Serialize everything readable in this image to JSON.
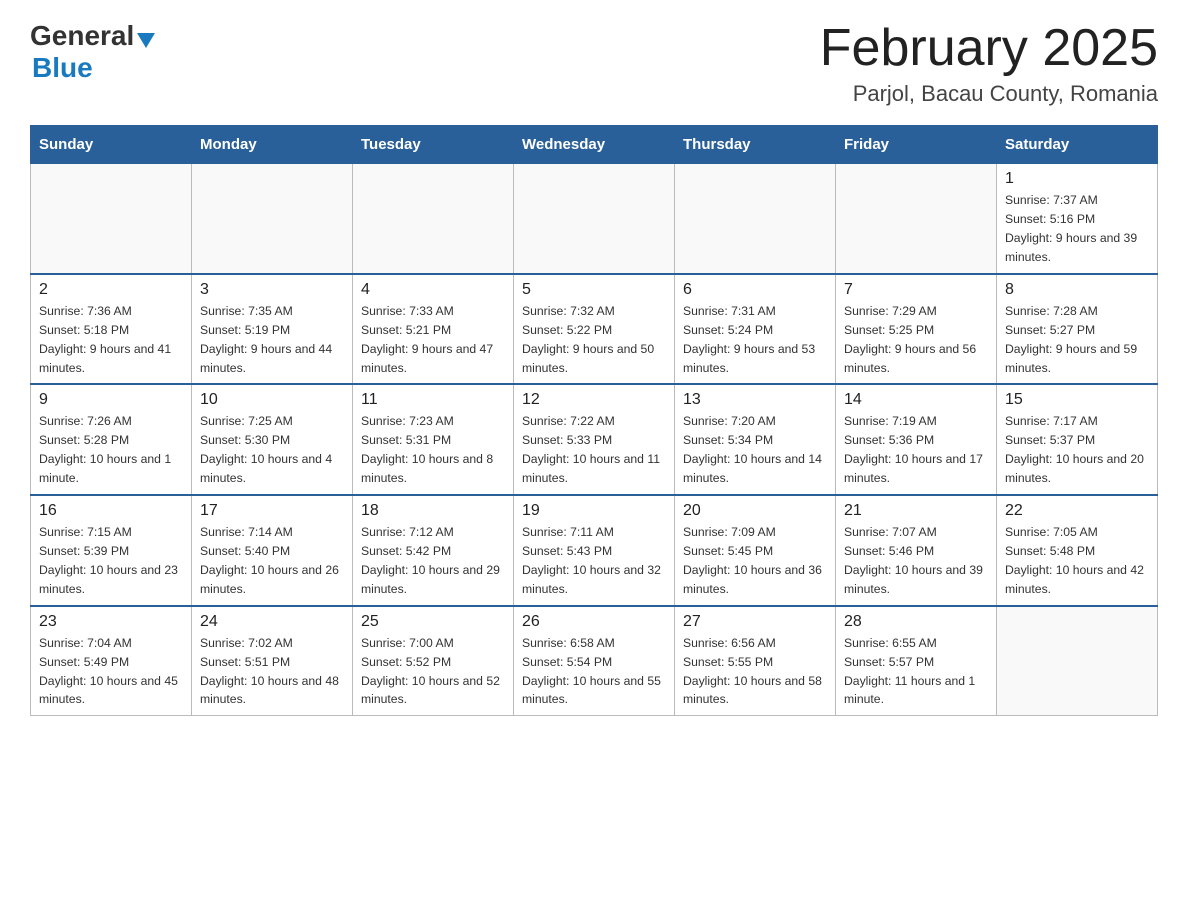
{
  "header": {
    "logo_general": "General",
    "logo_blue": "Blue",
    "month_title": "February 2025",
    "location": "Parjol, Bacau County, Romania"
  },
  "days_of_week": [
    "Sunday",
    "Monday",
    "Tuesday",
    "Wednesday",
    "Thursday",
    "Friday",
    "Saturday"
  ],
  "weeks": [
    [
      {
        "day": "",
        "info": ""
      },
      {
        "day": "",
        "info": ""
      },
      {
        "day": "",
        "info": ""
      },
      {
        "day": "",
        "info": ""
      },
      {
        "day": "",
        "info": ""
      },
      {
        "day": "",
        "info": ""
      },
      {
        "day": "1",
        "info": "Sunrise: 7:37 AM\nSunset: 5:16 PM\nDaylight: 9 hours and 39 minutes."
      }
    ],
    [
      {
        "day": "2",
        "info": "Sunrise: 7:36 AM\nSunset: 5:18 PM\nDaylight: 9 hours and 41 minutes."
      },
      {
        "day": "3",
        "info": "Sunrise: 7:35 AM\nSunset: 5:19 PM\nDaylight: 9 hours and 44 minutes."
      },
      {
        "day": "4",
        "info": "Sunrise: 7:33 AM\nSunset: 5:21 PM\nDaylight: 9 hours and 47 minutes."
      },
      {
        "day": "5",
        "info": "Sunrise: 7:32 AM\nSunset: 5:22 PM\nDaylight: 9 hours and 50 minutes."
      },
      {
        "day": "6",
        "info": "Sunrise: 7:31 AM\nSunset: 5:24 PM\nDaylight: 9 hours and 53 minutes."
      },
      {
        "day": "7",
        "info": "Sunrise: 7:29 AM\nSunset: 5:25 PM\nDaylight: 9 hours and 56 minutes."
      },
      {
        "day": "8",
        "info": "Sunrise: 7:28 AM\nSunset: 5:27 PM\nDaylight: 9 hours and 59 minutes."
      }
    ],
    [
      {
        "day": "9",
        "info": "Sunrise: 7:26 AM\nSunset: 5:28 PM\nDaylight: 10 hours and 1 minute."
      },
      {
        "day": "10",
        "info": "Sunrise: 7:25 AM\nSunset: 5:30 PM\nDaylight: 10 hours and 4 minutes."
      },
      {
        "day": "11",
        "info": "Sunrise: 7:23 AM\nSunset: 5:31 PM\nDaylight: 10 hours and 8 minutes."
      },
      {
        "day": "12",
        "info": "Sunrise: 7:22 AM\nSunset: 5:33 PM\nDaylight: 10 hours and 11 minutes."
      },
      {
        "day": "13",
        "info": "Sunrise: 7:20 AM\nSunset: 5:34 PM\nDaylight: 10 hours and 14 minutes."
      },
      {
        "day": "14",
        "info": "Sunrise: 7:19 AM\nSunset: 5:36 PM\nDaylight: 10 hours and 17 minutes."
      },
      {
        "day": "15",
        "info": "Sunrise: 7:17 AM\nSunset: 5:37 PM\nDaylight: 10 hours and 20 minutes."
      }
    ],
    [
      {
        "day": "16",
        "info": "Sunrise: 7:15 AM\nSunset: 5:39 PM\nDaylight: 10 hours and 23 minutes."
      },
      {
        "day": "17",
        "info": "Sunrise: 7:14 AM\nSunset: 5:40 PM\nDaylight: 10 hours and 26 minutes."
      },
      {
        "day": "18",
        "info": "Sunrise: 7:12 AM\nSunset: 5:42 PM\nDaylight: 10 hours and 29 minutes."
      },
      {
        "day": "19",
        "info": "Sunrise: 7:11 AM\nSunset: 5:43 PM\nDaylight: 10 hours and 32 minutes."
      },
      {
        "day": "20",
        "info": "Sunrise: 7:09 AM\nSunset: 5:45 PM\nDaylight: 10 hours and 36 minutes."
      },
      {
        "day": "21",
        "info": "Sunrise: 7:07 AM\nSunset: 5:46 PM\nDaylight: 10 hours and 39 minutes."
      },
      {
        "day": "22",
        "info": "Sunrise: 7:05 AM\nSunset: 5:48 PM\nDaylight: 10 hours and 42 minutes."
      }
    ],
    [
      {
        "day": "23",
        "info": "Sunrise: 7:04 AM\nSunset: 5:49 PM\nDaylight: 10 hours and 45 minutes."
      },
      {
        "day": "24",
        "info": "Sunrise: 7:02 AM\nSunset: 5:51 PM\nDaylight: 10 hours and 48 minutes."
      },
      {
        "day": "25",
        "info": "Sunrise: 7:00 AM\nSunset: 5:52 PM\nDaylight: 10 hours and 52 minutes."
      },
      {
        "day": "26",
        "info": "Sunrise: 6:58 AM\nSunset: 5:54 PM\nDaylight: 10 hours and 55 minutes."
      },
      {
        "day": "27",
        "info": "Sunrise: 6:56 AM\nSunset: 5:55 PM\nDaylight: 10 hours and 58 minutes."
      },
      {
        "day": "28",
        "info": "Sunrise: 6:55 AM\nSunset: 5:57 PM\nDaylight: 11 hours and 1 minute."
      },
      {
        "day": "",
        "info": ""
      }
    ]
  ]
}
